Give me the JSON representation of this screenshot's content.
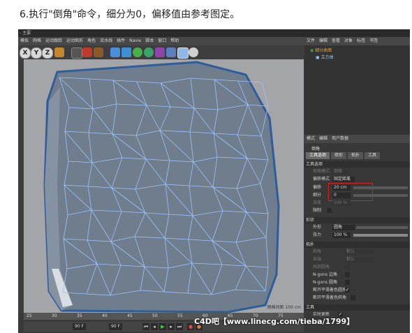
{
  "caption": "6.执行\"倒角\"命令，细分为0，偏移值由参考图定。",
  "app": {
    "title": "- 主要",
    "menu": [
      "模拟",
      "网格",
      "运动跟踪",
      "运动图形",
      "角色",
      "流水线",
      "插件",
      "Navie",
      "脚本",
      "窗口",
      "帮助"
    ],
    "axis_buttons": [
      "X",
      "Y",
      "Z"
    ],
    "viewport_label": "网格间距 100 cm",
    "ruler_ticks": [
      "25",
      "30",
      "35",
      "40",
      "45",
      "50",
      "55",
      "60",
      "65",
      "70",
      "75"
    ],
    "frame_field": "90 F",
    "frame_field2": "90 F"
  },
  "object_manager": {
    "menu": [
      "文件",
      "编辑",
      "查看",
      "对象",
      "标签",
      "书签"
    ],
    "rows": [
      "细分曲面",
      "立方体"
    ]
  },
  "attributes": {
    "menu": [
      "模式",
      "编辑",
      "用户数据"
    ],
    "tool_name": "倒角",
    "tabs": [
      "工具选项",
      "修形",
      "拓扑",
      "工具"
    ],
    "sections": {
      "tool_options": "工具选项",
      "shaping": "形状",
      "topology": "拓扑",
      "tool": "工具"
    },
    "props": {
      "bevel_mode_label": "倒角模式",
      "bevel_mode_value": "倒棱",
      "offset_mode_label": "偏移模式",
      "offset_mode_value": "固定距离",
      "offset_label": "偏移",
      "offset_value": "20 cm",
      "subdivision_label": "细分",
      "subdivision_value": "0",
      "depth_label": "深度",
      "depth_value": "100 %",
      "limit_label": "限制",
      "shape_label": "外形",
      "shape_value": "圆角",
      "tension_label": "张力",
      "tension_value": "100 %",
      "miter_label": "斜角",
      "miter_value": "默认",
      "end_label": "末端",
      "end_value": "默认",
      "partial_label": "局部圆角",
      "ngon_side_label": "N-gons 边角",
      "ngon_round_label": "N-gons 圆角",
      "phong_break_label": "断开平滑着色圆角",
      "phong_mitering_label": "断开平滑着色斜角",
      "realtime_label": "实时更新"
    }
  },
  "watermark": "C4D吧【www.linecg.com/tieba/1799】",
  "colors": {
    "viewport_bg": "#a3a5a8",
    "mesh_fill": "#6f7d8d",
    "mesh_line": "#9ec4ff",
    "mesh_edge": "#2e5d9a",
    "highlight_box": "#d42020"
  }
}
